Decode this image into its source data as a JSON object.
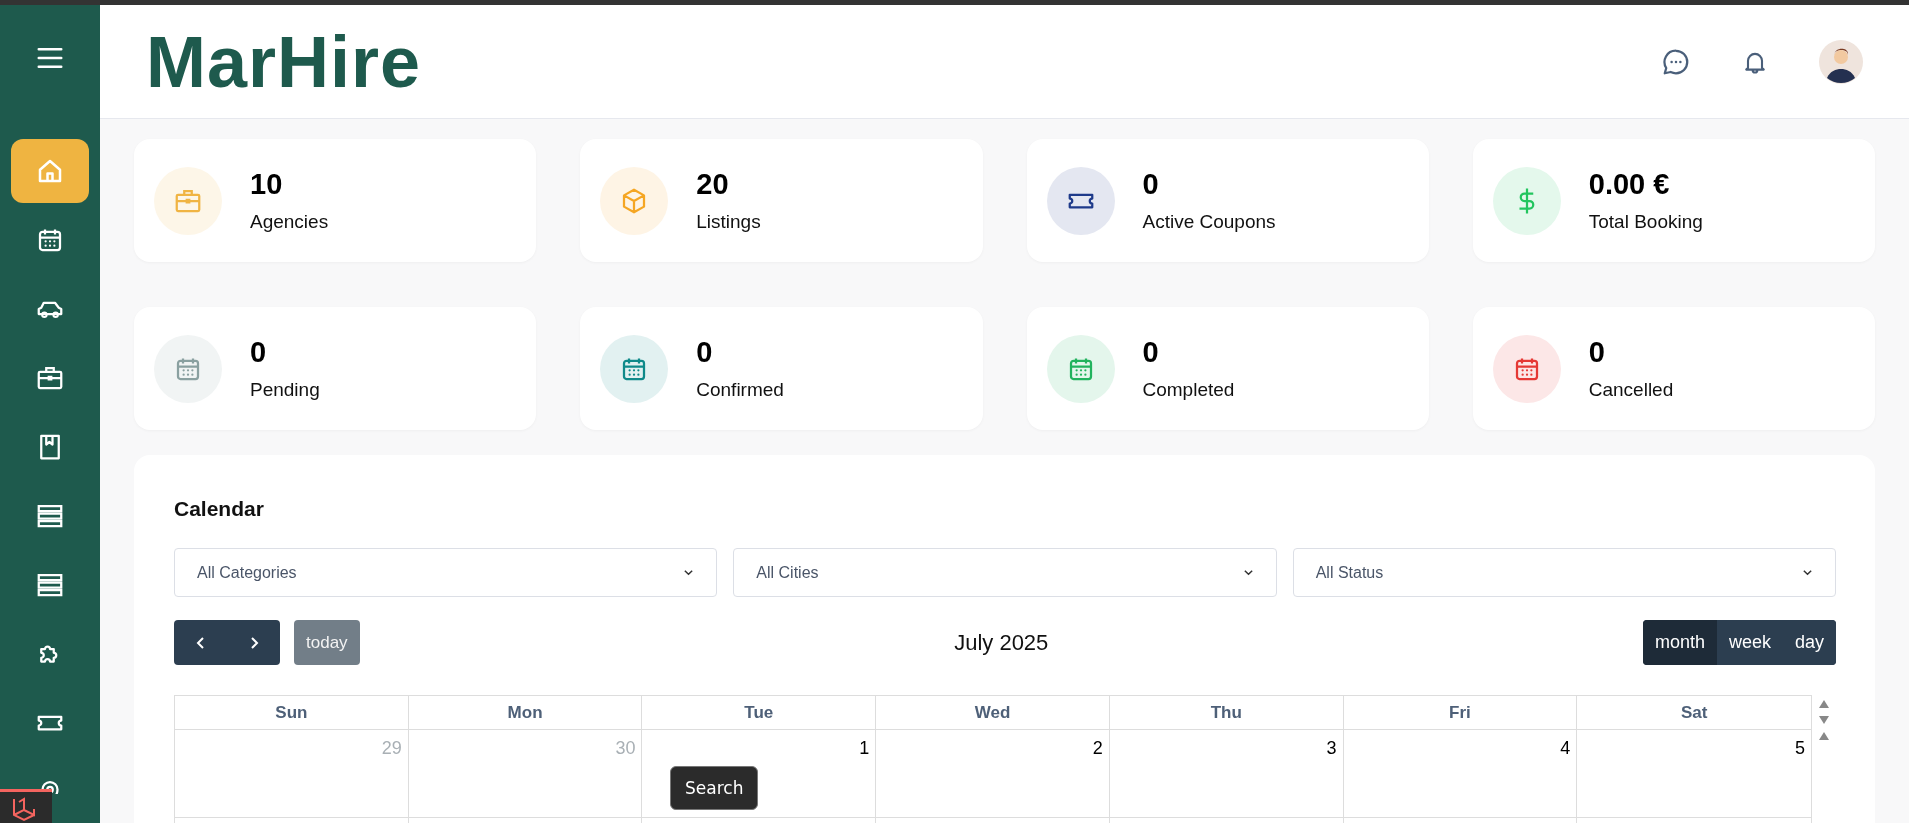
{
  "sidebar": {
    "items": [
      {
        "kind": "home",
        "selected": true
      },
      {
        "kind": "calendar",
        "selected": false
      },
      {
        "kind": "car",
        "selected": false
      },
      {
        "kind": "briefcase",
        "selected": false
      },
      {
        "kind": "book",
        "selected": false
      },
      {
        "kind": "list",
        "selected": false
      },
      {
        "kind": "list",
        "selected": false
      },
      {
        "kind": "puzzle",
        "selected": false
      },
      {
        "kind": "ticket",
        "selected": false
      },
      {
        "kind": "pin",
        "selected": false
      }
    ]
  },
  "header": {
    "logo": "MarHire"
  },
  "stats": [
    {
      "value": "10",
      "label": "Agencies",
      "kind": "briefcase",
      "color": "#f0b443"
    },
    {
      "value": "20",
      "label": "Listings",
      "kind": "box",
      "color": "#f5a623"
    },
    {
      "value": "0",
      "label": "Active Coupons",
      "kind": "ticket",
      "color": "#1e3a8a"
    },
    {
      "value": "0.00 €",
      "label": "Total Booking",
      "kind": "dollar",
      "color": "#22c55e"
    },
    {
      "value": "0",
      "label": "Pending",
      "kind": "calendar",
      "color": "#8aa0a0"
    },
    {
      "value": "0",
      "label": "Confirmed",
      "kind": "calendar",
      "color": "#0f8a8a"
    },
    {
      "value": "0",
      "label": "Completed",
      "kind": "calendar",
      "color": "#22b35e"
    },
    {
      "value": "0",
      "label": "Cancelled",
      "kind": "calendar",
      "color": "#e53935"
    }
  ],
  "calendar": {
    "title": "Calendar",
    "filters": [
      {
        "value": "All Categories"
      },
      {
        "value": "All Cities"
      },
      {
        "value": "All Status"
      }
    ],
    "today_button": "today",
    "title_text": "July 2025",
    "views": [
      {
        "label": "month",
        "selected": true
      },
      {
        "label": "week",
        "selected": false
      },
      {
        "label": "day",
        "selected": false
      }
    ],
    "weekdays": [
      "Sun",
      "Mon",
      "Tue",
      "Wed",
      "Thu",
      "Fri",
      "Sat"
    ],
    "days": [
      {
        "label": "29",
        "other_month": true
      },
      {
        "label": "30",
        "other_month": true
      },
      {
        "label": "1",
        "other_month": false
      },
      {
        "label": "2",
        "other_month": false
      },
      {
        "label": "3",
        "other_month": false
      },
      {
        "label": "4",
        "other_month": false
      },
      {
        "label": "5",
        "other_month": false
      }
    ]
  },
  "tooltip": "Search"
}
